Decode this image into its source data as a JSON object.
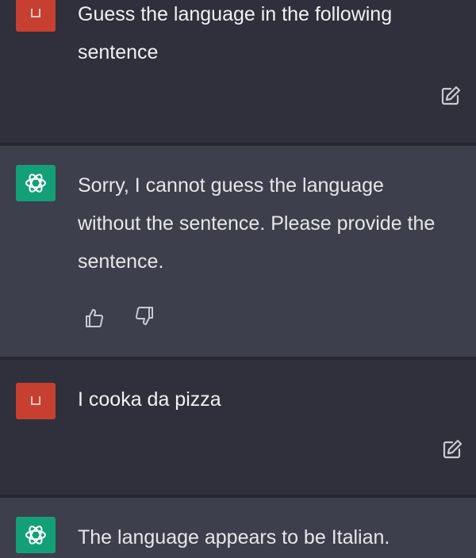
{
  "messages": [
    {
      "role": "user",
      "avatar_icon": "user-avatar-icon",
      "text": "Guess the language in the following sentence"
    },
    {
      "role": "assistant",
      "avatar_icon": "openai-logo-icon",
      "text": "Sorry, I cannot guess the language without the sentence. Please provide the sentence."
    },
    {
      "role": "user",
      "avatar_icon": "user-avatar-icon",
      "text": "I cooka da pizza"
    },
    {
      "role": "assistant",
      "avatar_icon": "openai-logo-icon",
      "text": "The language appears to be Italian."
    }
  ],
  "colors": {
    "user_bg": "#2f303b",
    "assistant_bg": "#3d3f4c",
    "user_avatar": "#c63f30",
    "assistant_avatar": "#139f78",
    "text": "#e6e7ea",
    "icon": "#c9cbd2"
  }
}
